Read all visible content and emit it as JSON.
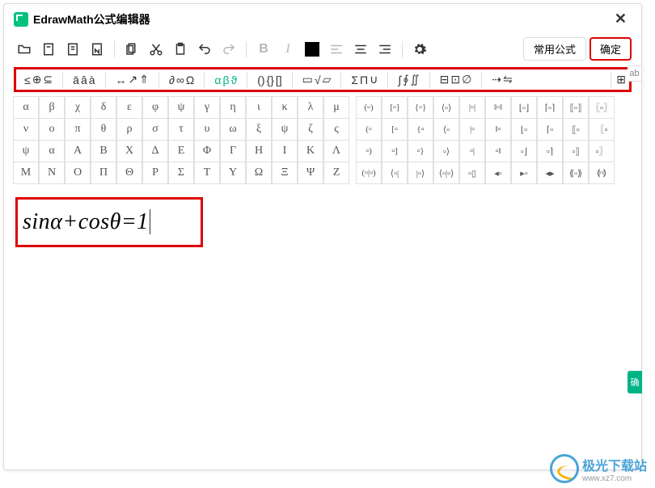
{
  "title": "EdrawMath公式编辑器",
  "toolbar": {
    "common_formula": "常用公式",
    "confirm": "确定"
  },
  "categories": [
    {
      "items": [
        "≤",
        "⊕",
        "⊆"
      ]
    },
    {
      "items": [
        "ā",
        "â",
        "à"
      ]
    },
    {
      "items": [
        "↔",
        "↗",
        "⇑"
      ]
    },
    {
      "items": [
        "∂",
        "∞",
        "Ω"
      ]
    },
    {
      "items": [
        "α",
        "β",
        "ϑ"
      ],
      "selected": true
    },
    {
      "items": [
        "()",
        "{}",
        "[]"
      ]
    },
    {
      "items": [
        "▭",
        "√",
        "▱"
      ]
    },
    {
      "items": [
        "Σ",
        "Π",
        "∪"
      ]
    },
    {
      "items": [
        "∫",
        "∮",
        "∬"
      ]
    },
    {
      "items": [
        "⊟",
        "⊡",
        "∅"
      ]
    },
    {
      "items": [
        "⇢",
        "⇋"
      ]
    }
  ],
  "cat_tail": "⊞",
  "greek_grid": {
    "rows": [
      [
        "α",
        "β",
        "χ",
        "δ",
        "ε",
        "φ",
        "ψ",
        "γ",
        "η",
        "ι",
        "κ",
        "λ",
        "μ"
      ],
      [
        "ν",
        "ο",
        "π",
        "θ",
        "ρ",
        "σ",
        "τ",
        "υ",
        "ω",
        "ξ",
        "ψ",
        "ζ",
        "ς"
      ],
      [
        "ψ",
        "α",
        "Α",
        "Β",
        "Χ",
        "Δ",
        "Ε",
        "Φ",
        "Γ",
        "Η",
        "Ι",
        "Κ",
        "Λ"
      ],
      [
        "Μ",
        "Ν",
        "Ο",
        "Π",
        "Θ",
        "Ρ",
        "Σ",
        "Τ",
        "Υ",
        "Ω",
        "Ξ",
        "Ψ",
        "Ζ"
      ]
    ]
  },
  "bracket_grid": {
    "rows": [
      [
        "(▫)",
        "[▫]",
        "{▫}",
        "⟨▫⟩",
        "|▫|",
        "‖▫‖",
        "⌊▫⌋",
        "⌈▫⌉",
        "⟦▫⟧",
        "〖▫〗"
      ],
      [
        "(▫",
        "[▫",
        "{▫",
        "⟨▫",
        "|▫",
        "‖▫",
        "⌊▫",
        "⌈▫",
        "⟦▫",
        "〖▫"
      ],
      [
        "▫)",
        "▫]",
        "▫}",
        "▫⟩",
        "▫|",
        "▫‖",
        "▫⌋",
        "▫⌉",
        "▫⟧",
        "▫〗"
      ],
      [
        "(▫|▫)",
        "⟨▫|",
        "|▫⟩",
        "⟨▫|▫⟩",
        "▫▯",
        "◂▫",
        "▸▫",
        "◂▸",
        "⟪▫⟫",
        "⟬▫⟭"
      ]
    ]
  },
  "formula": "sinα+cosθ=1",
  "side_tab": "ab",
  "green_edge": "确",
  "watermark": {
    "brand": "极光下载站",
    "url": "www.xz7.com"
  }
}
